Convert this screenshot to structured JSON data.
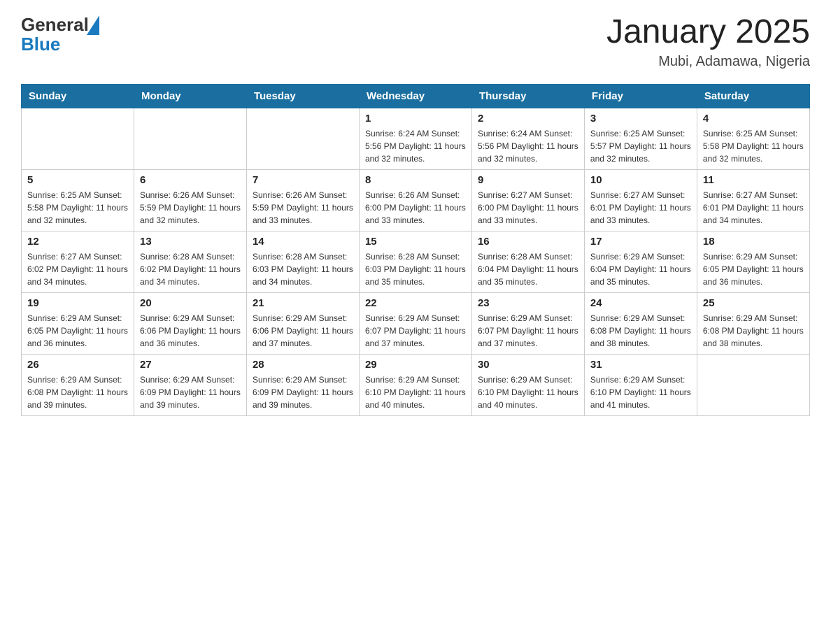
{
  "header": {
    "logo_general": "General",
    "logo_blue": "Blue",
    "month_title": "January 2025",
    "location": "Mubi, Adamawa, Nigeria"
  },
  "calendar": {
    "days_of_week": [
      "Sunday",
      "Monday",
      "Tuesday",
      "Wednesday",
      "Thursday",
      "Friday",
      "Saturday"
    ],
    "weeks": [
      [
        {
          "day": "",
          "info": ""
        },
        {
          "day": "",
          "info": ""
        },
        {
          "day": "",
          "info": ""
        },
        {
          "day": "1",
          "info": "Sunrise: 6:24 AM\nSunset: 5:56 PM\nDaylight: 11 hours and 32 minutes."
        },
        {
          "day": "2",
          "info": "Sunrise: 6:24 AM\nSunset: 5:56 PM\nDaylight: 11 hours and 32 minutes."
        },
        {
          "day": "3",
          "info": "Sunrise: 6:25 AM\nSunset: 5:57 PM\nDaylight: 11 hours and 32 minutes."
        },
        {
          "day": "4",
          "info": "Sunrise: 6:25 AM\nSunset: 5:58 PM\nDaylight: 11 hours and 32 minutes."
        }
      ],
      [
        {
          "day": "5",
          "info": "Sunrise: 6:25 AM\nSunset: 5:58 PM\nDaylight: 11 hours and 32 minutes."
        },
        {
          "day": "6",
          "info": "Sunrise: 6:26 AM\nSunset: 5:59 PM\nDaylight: 11 hours and 32 minutes."
        },
        {
          "day": "7",
          "info": "Sunrise: 6:26 AM\nSunset: 5:59 PM\nDaylight: 11 hours and 33 minutes."
        },
        {
          "day": "8",
          "info": "Sunrise: 6:26 AM\nSunset: 6:00 PM\nDaylight: 11 hours and 33 minutes."
        },
        {
          "day": "9",
          "info": "Sunrise: 6:27 AM\nSunset: 6:00 PM\nDaylight: 11 hours and 33 minutes."
        },
        {
          "day": "10",
          "info": "Sunrise: 6:27 AM\nSunset: 6:01 PM\nDaylight: 11 hours and 33 minutes."
        },
        {
          "day": "11",
          "info": "Sunrise: 6:27 AM\nSunset: 6:01 PM\nDaylight: 11 hours and 34 minutes."
        }
      ],
      [
        {
          "day": "12",
          "info": "Sunrise: 6:27 AM\nSunset: 6:02 PM\nDaylight: 11 hours and 34 minutes."
        },
        {
          "day": "13",
          "info": "Sunrise: 6:28 AM\nSunset: 6:02 PM\nDaylight: 11 hours and 34 minutes."
        },
        {
          "day": "14",
          "info": "Sunrise: 6:28 AM\nSunset: 6:03 PM\nDaylight: 11 hours and 34 minutes."
        },
        {
          "day": "15",
          "info": "Sunrise: 6:28 AM\nSunset: 6:03 PM\nDaylight: 11 hours and 35 minutes."
        },
        {
          "day": "16",
          "info": "Sunrise: 6:28 AM\nSunset: 6:04 PM\nDaylight: 11 hours and 35 minutes."
        },
        {
          "day": "17",
          "info": "Sunrise: 6:29 AM\nSunset: 6:04 PM\nDaylight: 11 hours and 35 minutes."
        },
        {
          "day": "18",
          "info": "Sunrise: 6:29 AM\nSunset: 6:05 PM\nDaylight: 11 hours and 36 minutes."
        }
      ],
      [
        {
          "day": "19",
          "info": "Sunrise: 6:29 AM\nSunset: 6:05 PM\nDaylight: 11 hours and 36 minutes."
        },
        {
          "day": "20",
          "info": "Sunrise: 6:29 AM\nSunset: 6:06 PM\nDaylight: 11 hours and 36 minutes."
        },
        {
          "day": "21",
          "info": "Sunrise: 6:29 AM\nSunset: 6:06 PM\nDaylight: 11 hours and 37 minutes."
        },
        {
          "day": "22",
          "info": "Sunrise: 6:29 AM\nSunset: 6:07 PM\nDaylight: 11 hours and 37 minutes."
        },
        {
          "day": "23",
          "info": "Sunrise: 6:29 AM\nSunset: 6:07 PM\nDaylight: 11 hours and 37 minutes."
        },
        {
          "day": "24",
          "info": "Sunrise: 6:29 AM\nSunset: 6:08 PM\nDaylight: 11 hours and 38 minutes."
        },
        {
          "day": "25",
          "info": "Sunrise: 6:29 AM\nSunset: 6:08 PM\nDaylight: 11 hours and 38 minutes."
        }
      ],
      [
        {
          "day": "26",
          "info": "Sunrise: 6:29 AM\nSunset: 6:08 PM\nDaylight: 11 hours and 39 minutes."
        },
        {
          "day": "27",
          "info": "Sunrise: 6:29 AM\nSunset: 6:09 PM\nDaylight: 11 hours and 39 minutes."
        },
        {
          "day": "28",
          "info": "Sunrise: 6:29 AM\nSunset: 6:09 PM\nDaylight: 11 hours and 39 minutes."
        },
        {
          "day": "29",
          "info": "Sunrise: 6:29 AM\nSunset: 6:10 PM\nDaylight: 11 hours and 40 minutes."
        },
        {
          "day": "30",
          "info": "Sunrise: 6:29 AM\nSunset: 6:10 PM\nDaylight: 11 hours and 40 minutes."
        },
        {
          "day": "31",
          "info": "Sunrise: 6:29 AM\nSunset: 6:10 PM\nDaylight: 11 hours and 41 minutes."
        },
        {
          "day": "",
          "info": ""
        }
      ]
    ]
  }
}
